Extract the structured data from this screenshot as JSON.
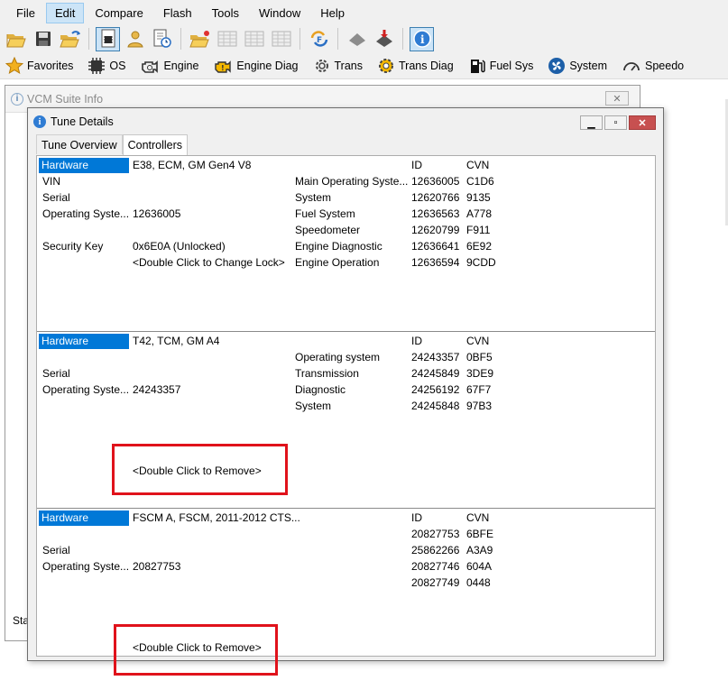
{
  "menubar": {
    "items": [
      "File",
      "Edit",
      "Compare",
      "Flash",
      "Tools",
      "Window",
      "Help"
    ],
    "active": "Edit"
  },
  "modules": [
    {
      "name": "favorites",
      "label": "Favorites"
    },
    {
      "name": "os",
      "label": "OS"
    },
    {
      "name": "engine",
      "label": "Engine"
    },
    {
      "name": "engine-diag",
      "label": "Engine Diag"
    },
    {
      "name": "trans",
      "label": "Trans"
    },
    {
      "name": "trans-diag",
      "label": "Trans Diag"
    },
    {
      "name": "fuel-sys",
      "label": "Fuel Sys"
    },
    {
      "name": "system",
      "label": "System"
    },
    {
      "name": "speedo",
      "label": "Speedo"
    }
  ],
  "back_window": {
    "title": "VCM Suite Info",
    "status_text": "Sta"
  },
  "tune_details": {
    "title": "Tune Details",
    "tabs": [
      "Tune Overview",
      "Controllers"
    ],
    "active_tab": "Controllers",
    "controllers": [
      {
        "hardware_label": "Hardware",
        "hardware_value": "E38, ECM, GM Gen4 V8",
        "left_rows": [
          {
            "label": "VIN",
            "value": ""
          },
          {
            "label": "Serial",
            "value": ""
          },
          {
            "label": "Operating Syste...",
            "value": "12636005"
          },
          {
            "label": "",
            "value": ""
          },
          {
            "label": "Security Key",
            "value": "0x6E0A (Unlocked)"
          },
          {
            "label": "",
            "value": "<Double Click to Change Lock>"
          }
        ],
        "id_header": "ID",
        "cvn_header": "CVN",
        "modules": [
          {
            "name": "Main Operating Syste...",
            "id": "12636005",
            "cvn": "C1D6"
          },
          {
            "name": "System",
            "id": "12620766",
            "cvn": "9135"
          },
          {
            "name": "Fuel System",
            "id": "12636563",
            "cvn": "A778"
          },
          {
            "name": "Speedometer",
            "id": "12620799",
            "cvn": "F911"
          },
          {
            "name": "Engine Diagnostic",
            "id": "12636641",
            "cvn": "6E92"
          },
          {
            "name": "Engine Operation",
            "id": "12636594",
            "cvn": "9CDD"
          }
        ]
      },
      {
        "hardware_label": "Hardware",
        "hardware_value": "T42, TCM, GM A4",
        "left_rows": [
          {
            "label": "",
            "value": ""
          },
          {
            "label": "Serial",
            "value": ""
          },
          {
            "label": "Operating Syste...",
            "value": "24243357"
          }
        ],
        "id_header": "ID",
        "cvn_header": "CVN",
        "modules": [
          {
            "name": "Operating system",
            "id": "24243357",
            "cvn": "0BF5"
          },
          {
            "name": "Transmission",
            "id": "24245849",
            "cvn": "3DE9"
          },
          {
            "name": "Diagnostic",
            "id": "24256192",
            "cvn": "67F7"
          },
          {
            "name": "System",
            "id": "24245848",
            "cvn": "97B3"
          }
        ],
        "remove_text": "<Double Click to Remove>"
      },
      {
        "hardware_label": "Hardware",
        "hardware_value": "FSCM A, FSCM, 2011-2012 CTS...",
        "left_rows": [
          {
            "label": "",
            "value": ""
          },
          {
            "label": "Serial",
            "value": ""
          },
          {
            "label": "Operating Syste...",
            "value": "20827753"
          }
        ],
        "id_header": "ID",
        "cvn_header": "CVN",
        "modules": [
          {
            "name": "",
            "id": "20827753",
            "cvn": "6BFE"
          },
          {
            "name": "",
            "id": "25862266",
            "cvn": "A3A9"
          },
          {
            "name": "",
            "id": "20827746",
            "cvn": "604A"
          },
          {
            "name": "",
            "id": "20827749",
            "cvn": "0448"
          }
        ],
        "remove_text": "<Double Click to Remove>"
      }
    ]
  },
  "colors": {
    "selection": "#0078d7",
    "highlight_box": "#e0121b",
    "close_button": "#c75050"
  }
}
